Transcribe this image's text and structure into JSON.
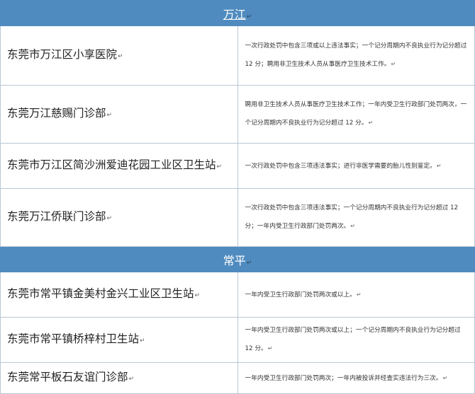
{
  "sections": [
    {
      "title": "万江",
      "rows": [
        {
          "name": "东莞市万江区小享医院",
          "desc": "一次行政处罚中包含三项或以上违法事实；一个记分周期内不良执业行为记分超过 12 分；聘用非卫生技术人员从事医疗卫生技术工作。"
        },
        {
          "name": "东莞万江慈赐门诊部",
          "desc": "聘用非卫生技术人员从事医疗卫生技术工作；一年内受卫生行政部门处罚两次，一个记分周期内不良执业行为记分超过 12 分。"
        },
        {
          "name": "东莞市万江区简沙洲爱迪花园工业区卫生站",
          "desc": "一次行政处罚中包含三项违法事实；进行非医学需要的胎儿性别鉴定。"
        },
        {
          "name": "东莞万江侨联门诊部",
          "desc": "一次行政处罚中包含三项违法事实；一个记分周期内不良执业行为记分超过 12 分；一年内受卫生行政部门处罚两次。"
        }
      ]
    },
    {
      "title": "常平",
      "rows": [
        {
          "name": "东莞市常平镇金美村金兴工业区卫生站",
          "desc": "一年内受卫生行政部门处罚两次或以上。"
        },
        {
          "name": "东莞市常平镇桥梓村卫生站",
          "desc": "一年内受卫生行政部门处罚两次或以上；一个记分周期内不良执业行为记分超过 12 分。"
        },
        {
          "name": "东莞常平板石友谊门诊部",
          "desc": "一年内受卫生行政部门处罚两次；一年内被投诉并经查实违法行为三次。"
        }
      ]
    }
  ],
  "paragraph_mark": "↵"
}
